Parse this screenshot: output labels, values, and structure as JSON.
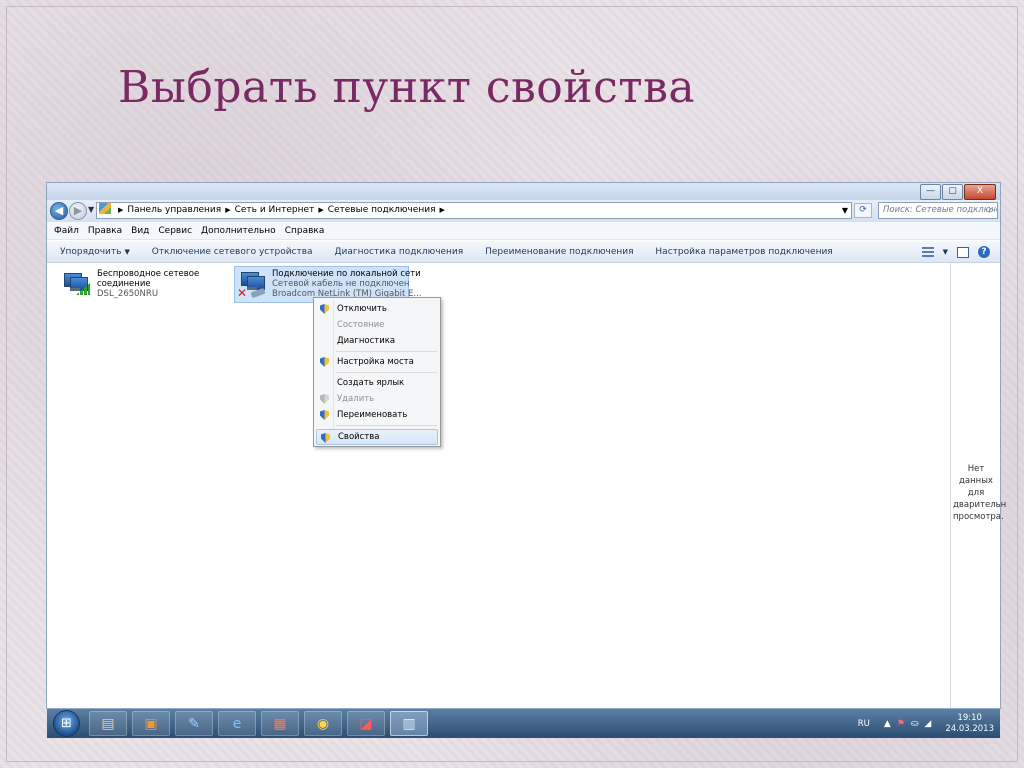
{
  "slide": {
    "title": "Выбрать пункт свойства"
  },
  "window": {
    "buttons": {
      "minimize": "—",
      "maximize": "▢",
      "close": "X"
    },
    "address": {
      "crumbs": [
        "Панель управления",
        "Сеть и Интернет",
        "Сетевые подключения"
      ],
      "search_placeholder": "Поиск: Сетевые подключения"
    },
    "menu": [
      "Файл",
      "Правка",
      "Вид",
      "Сервис",
      "Дополнительно",
      "Справка"
    ],
    "commands": {
      "organize": "Упорядочить",
      "items": [
        "Отключение сетевого устройства",
        "Диагностика подключения",
        "Переименование подключения",
        "Настройка параметров подключения"
      ]
    },
    "connections": [
      {
        "line1": "Беспроводное сетевое",
        "line2": "соединение",
        "line3": "DSL_2650NRU"
      },
      {
        "line1": "Подключение по локальной сети",
        "line2": "Сетевой кабель не подключен",
        "line3": "Broadcom NetLink (TM) Gigabit E..."
      }
    ],
    "preview_text": "Нет данных для дварительн просмотра."
  },
  "context_menu": {
    "items": [
      {
        "label": "Отключить",
        "state": "normal",
        "shield": true
      },
      {
        "label": "Состояние",
        "state": "disabled",
        "shield": false
      },
      {
        "label": "Диагностика",
        "state": "normal",
        "shield": false
      },
      {
        "label": "Настройка моста",
        "state": "normal",
        "shield": true
      },
      {
        "label": "Создать ярлык",
        "state": "normal",
        "shield": false
      },
      {
        "label": "Удалить",
        "state": "disabled",
        "shield": true
      },
      {
        "label": "Переименовать",
        "state": "normal",
        "shield": true
      },
      {
        "label": "Свойства",
        "state": "selected",
        "shield": true
      }
    ]
  },
  "taskbar": {
    "apps": [
      "explorer-icon",
      "media-player-icon",
      "paint-icon",
      "ie-icon",
      "powerpoint-icon",
      "chrome-icon",
      "acrobat-icon",
      "control-panel-icon"
    ],
    "tray": {
      "language": "RU",
      "time": "19:10",
      "date": "24.03.2013"
    }
  }
}
